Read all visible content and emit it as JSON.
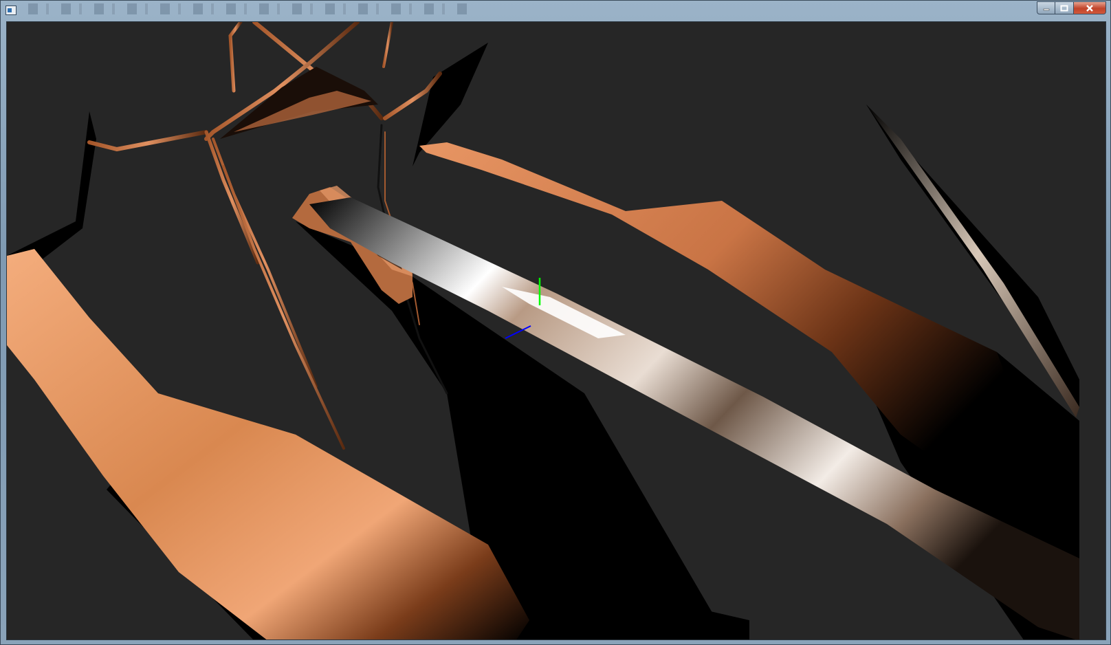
{
  "window": {
    "title": "",
    "icon": "app-window-icon",
    "controls": [
      {
        "name": "minimize",
        "icon": "minimize-icon",
        "symbol": "—"
      },
      {
        "name": "maximize",
        "icon": "maximize-icon",
        "symbol": "☐"
      },
      {
        "name": "close",
        "icon": "close-icon",
        "symbol": "✕"
      }
    ]
  },
  "scene": {
    "background": "#262626",
    "material": "copper",
    "colors": {
      "copper_light": "#f2a978",
      "copper_mid": "#c9794a",
      "copper_dark": "#5a2d16",
      "shadow": "#000000",
      "chrome_highlight": "#ffffff",
      "chrome_mid": "#b9a08a"
    },
    "gizmo": {
      "y_axis_color": "#00ff00",
      "z_axis_color": "#0000ff"
    }
  }
}
